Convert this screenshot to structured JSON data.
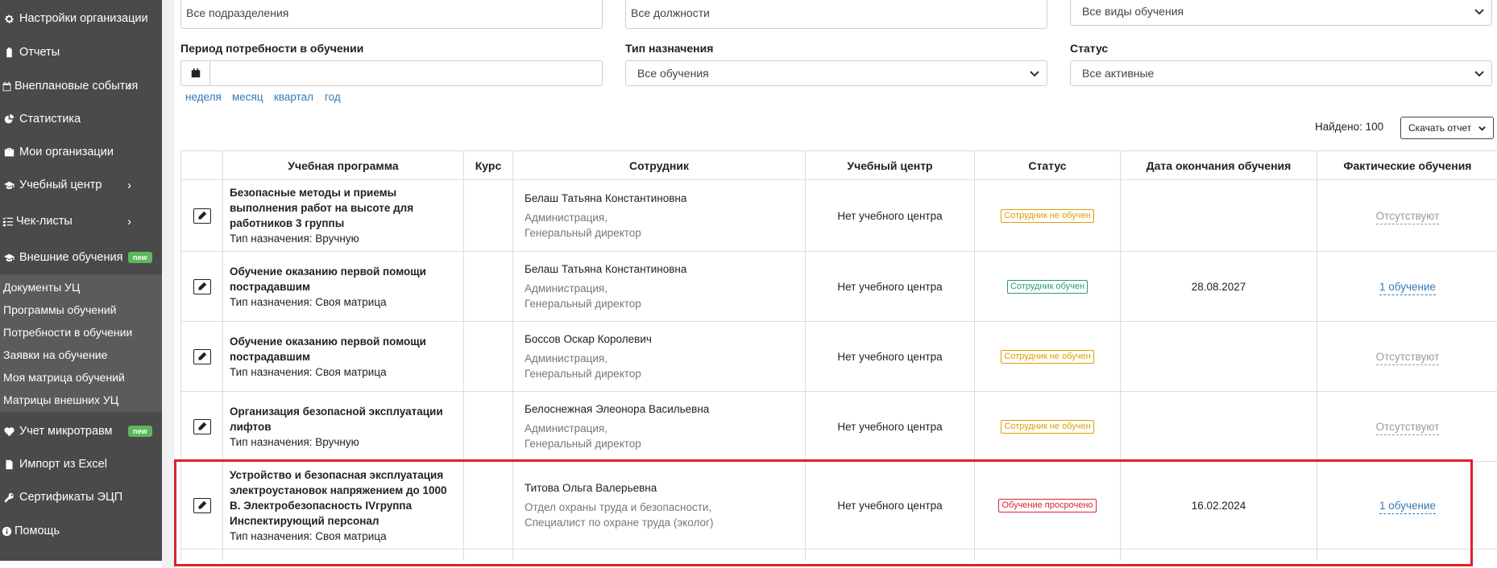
{
  "sidebar": {
    "items": [
      {
        "label": "Настройки организации",
        "icon": "gear-icon"
      },
      {
        "label": "Отчеты",
        "icon": "clipboard-icon"
      },
      {
        "label": "Внеплановые события",
        "icon": "calendar-icon",
        "has_submenu": true
      },
      {
        "label": "Статистика",
        "icon": "pie-chart-icon"
      },
      {
        "label": "Мои организации",
        "icon": "briefcase-icon"
      },
      {
        "label": "Учебный центр",
        "icon": "graduation-cap-icon",
        "has_submenu": true
      },
      {
        "label": "Чек-листы",
        "icon": "checklist-icon",
        "has_submenu": true
      },
      {
        "label": "Внешние обучения",
        "icon": "graduation-cap-icon",
        "badge": "new"
      },
      {
        "label": "Учет микротравм",
        "icon": "heartbeat-icon",
        "badge": "new"
      },
      {
        "label": "Импорт из Excel",
        "icon": "file-icon"
      },
      {
        "label": "Сертификаты ЭЦП",
        "icon": "key-icon"
      },
      {
        "label": "Помощь",
        "icon": "info-icon"
      }
    ],
    "submenu": [
      "Документы УЦ",
      "Программы обучений",
      "Потребности в обучении",
      "Заявки на обучение",
      "Моя матрица обучений",
      "Матрицы внешних УЦ"
    ]
  },
  "filters": {
    "subdivisions_placeholder": "Все подразделения",
    "positions_placeholder": "Все должности",
    "training_types_value": "Все виды обучения",
    "period_label": "Период потребности в обучении",
    "assignment_type_label": "Тип назначения",
    "assignment_type_value": "Все обучения",
    "status_label": "Статус",
    "status_value": "Все активные",
    "period_links": [
      "неделя",
      "месяц",
      "квартал",
      "год"
    ]
  },
  "results": {
    "found_text": "Найдено: 100",
    "download_label": "Скачать отчет"
  },
  "table": {
    "headers": [
      "",
      "Учебная программа",
      "Курс",
      "Сотрудник",
      "Учебный центр",
      "Статус",
      "Дата окончания обучения",
      "Фактические обучения"
    ],
    "rows": [
      {
        "program": "Безопасные методы и приемы выполнения работ на высоте для работников 3 группы",
        "assignment": "Тип назначения: Вручную",
        "course": "",
        "employee": "Белаш Татьяна Константиновна",
        "dept": "Администрация,",
        "position": "Генеральный директор",
        "center": "Нет учебного центра",
        "status": "Сотрудник не обучен",
        "status_kind": "warn",
        "end_date": "",
        "fact": "Отсутствуют"
      },
      {
        "program": "Обучение оказанию первой помощи пострадавшим",
        "assignment": "Тип назначения: Своя матрица",
        "course": "",
        "employee": "Белаш Татьяна Константиновна",
        "dept": "Администрация,",
        "position": "Генеральный директор",
        "center": "Нет учебного центра",
        "status": "Сотрудник обучен",
        "status_kind": "ok",
        "end_date": "28.08.2027",
        "fact": "1 обучение"
      },
      {
        "program": "Обучение оказанию первой помощи пострадавшим",
        "assignment": "Тип назначения: Своя матрица",
        "course": "",
        "employee": "Боссов Оскар Королевич",
        "dept": "Администрация,",
        "position": "Генеральный директор",
        "center": "Нет учебного центра",
        "status": "Сотрудник не обучен",
        "status_kind": "warn",
        "end_date": "",
        "fact": "Отсутствуют"
      },
      {
        "program": "Организация безопасной эксплуатации лифтов",
        "assignment": "Тип назначения: Вручную",
        "course": "",
        "employee": "Белоснежная Элеонора Васильевна",
        "dept": "Администрация,",
        "position": "Генеральный директор",
        "center": "Нет учебного центра",
        "status": "Сотрудник не обучен",
        "status_kind": "warn",
        "end_date": "",
        "fact": "Отсутствуют"
      },
      {
        "program": "Устройство и безопасная эксплуатация электроустановок напряжением до 1000 В. Электробезопасность IVгруппа Инспектирующий персонал",
        "assignment": "Тип назначения: Своя матрица",
        "course": "",
        "employee": "Титова Ольга Валерьевна",
        "dept": "Отдел охраны труда и безопасности,",
        "position": "Специалист по охране труда (эколог)",
        "center": "Нет учебного центра",
        "status": "Обучение просрочено",
        "status_kind": "bad",
        "end_date": "16.02.2024",
        "fact": "1 обучение"
      }
    ]
  }
}
